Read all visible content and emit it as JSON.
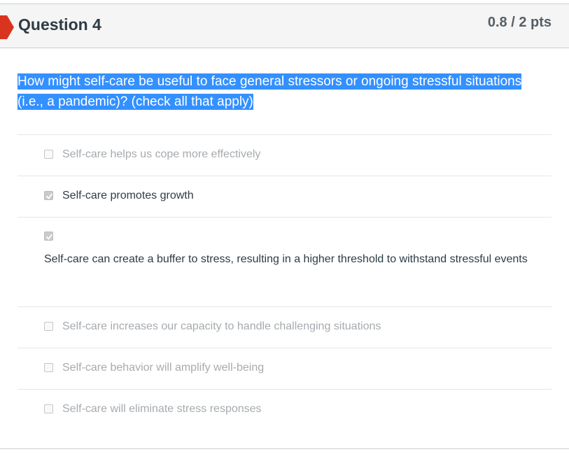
{
  "question": {
    "title": "Question 4",
    "points": "0.8 / 2 pts",
    "text": "How might self-care be useful to face general stressors or ongoing stressful situations (i.e., a pandemic)? (check all that apply)"
  },
  "answers": [
    {
      "label": "Self-care helps us cope more effectively",
      "checked": false
    },
    {
      "label": "Self-care promotes growth",
      "checked": true
    },
    {
      "label": "Self-care can create a buffer to stress, resulting in a higher threshold to withstand stressful events",
      "checked": true
    },
    {
      "label": "Self-care increases our capacity to handle challenging situations",
      "checked": false
    },
    {
      "label": "Self-care behavior will amplify well-being",
      "checked": false
    },
    {
      "label": "Self-care will eliminate stress responses",
      "checked": false
    }
  ],
  "colors": {
    "flag": "#d9341f",
    "selection_highlight": "#3390ff",
    "header_bg": "#f5f5f5"
  },
  "icons": {
    "flag": "bookmark-flag-icon",
    "checkbox_checked": "checkmark-icon"
  }
}
